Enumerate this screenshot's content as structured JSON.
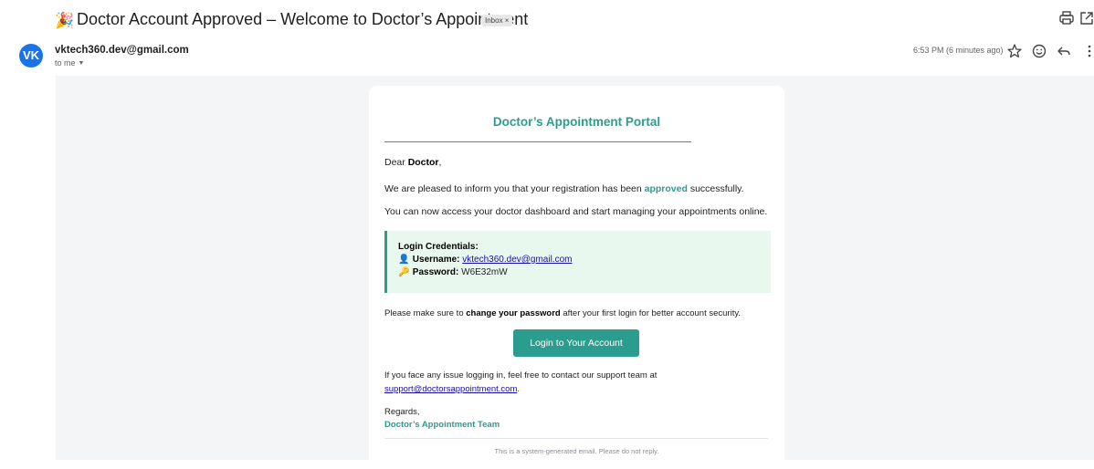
{
  "header": {
    "subject_emoji": "🎉",
    "subject": "Doctor Account Approved – Welcome to Doctor’s Appointment",
    "label_chip": "Inbox ×"
  },
  "sender": {
    "avatar_initials": "VK",
    "email": "vktech360.dev@gmail.com",
    "recipient": "to me",
    "time": "6:53 PM (6 minutes ago)"
  },
  "icons": {
    "print": "printer-icon",
    "new_window": "open-in-new-window-icon",
    "star": "star-icon",
    "emoji": "emoji-reaction-icon",
    "reply": "reply-icon",
    "more": "more-vertical-icon"
  },
  "email": {
    "portal_title": "Doctor’s Appointment Portal",
    "greeting_prefix": "Dear ",
    "greeting_name": "Doctor",
    "greeting_suffix": ",",
    "p1_prefix": "We are pleased to inform you that your registration has been ",
    "p1_highlight": "approved",
    "p1_suffix": " successfully.",
    "p2": "You can now access your doctor dashboard and start managing your appointments online.",
    "credentials": {
      "heading": "Login Credentials:",
      "username_emoji": "👤",
      "username_label": "Username:",
      "username_value": "vktech360.dev@gmail.com",
      "password_emoji": "🔑",
      "password_label": "Password:",
      "password_value": "W6E32mW"
    },
    "p3_prefix": "Please make sure to ",
    "p3_bold": "change your password",
    "p3_suffix": " after your first login for better account security.",
    "login_button": "Login to Your Account",
    "p4": "If you face any issue logging in, feel free to contact our support team at",
    "support_email": "support@doctorsappointment.com",
    "support_suffix": ".",
    "regards": "Regards,",
    "team": "Doctor’s Appointment Team",
    "footer": "This is a system-generated email. Please do not reply."
  },
  "colors": {
    "accent": "#2a9d8f",
    "credential_bg": "#e8f8ef",
    "avatar": "#1a73e8",
    "link": "#1a0dab"
  }
}
